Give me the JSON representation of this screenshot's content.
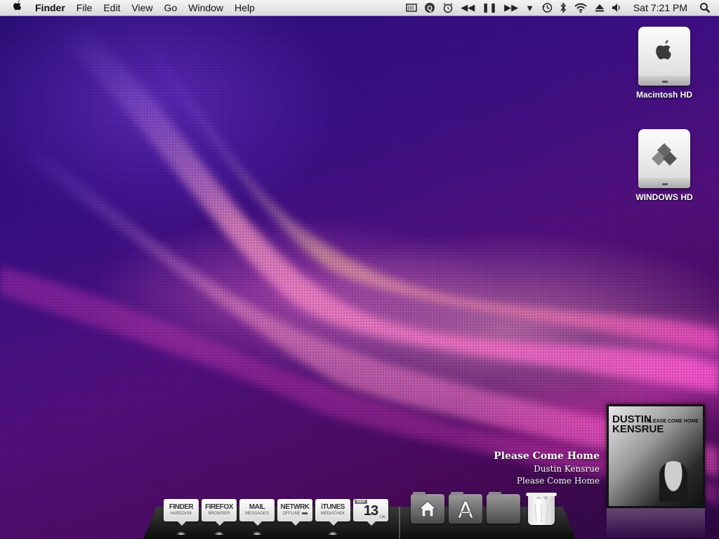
{
  "menubar": {
    "apple_glyph": "",
    "app_name": "Finder",
    "menus": [
      "File",
      "Edit",
      "View",
      "Go",
      "Window",
      "Help"
    ],
    "status_icons": [
      "menu-extra-icon",
      "quicksilver-icon",
      "alarm-icon",
      "previous-track-icon",
      "pause-icon",
      "next-track-icon",
      "dropdown-icon",
      "time-machine-icon",
      "bluetooth-icon",
      "wifi-icon",
      "eject-icon",
      "volume-icon"
    ],
    "clock": "Sat 7:21 PM",
    "spotlight_icon": "spotlight-icon"
  },
  "desktop_icons": [
    {
      "label": "Macintosh HD",
      "icon": "apple-drive-icon"
    },
    {
      "label": "WINDOWS HD",
      "icon": "windows-drive-icon"
    }
  ],
  "now_playing": {
    "title": "Please Come Home",
    "artist": "Dustin Kensrue",
    "album": "Please Come Home",
    "cover_artist": "DUSTIN KENSRUE",
    "cover_title": "PLEASE COME HOME"
  },
  "dock": {
    "tiles": [
      {
        "title": "FINDER",
        "sub": "HARDDISK"
      },
      {
        "title": "FIREFOX",
        "sub": "BROWSER"
      },
      {
        "title": "MAIL",
        "sub": "MESSAGES"
      },
      {
        "title": "NETWRK",
        "sub": "OFFLINE"
      },
      {
        "title": "iTUNES",
        "sub": "MEDIATHEK"
      }
    ],
    "calendar": {
      "month": "SEP",
      "day": "13",
      "label": "CAL"
    },
    "folders": [
      "home-folder-icon",
      "applications-folder-icon",
      "documents-folder-icon"
    ],
    "trash_icon": "trash-icon"
  },
  "colors": {
    "menubar": "#e6e6e6",
    "desktop_base": "#3a0f86",
    "accent_pink": "#ff4fd0"
  }
}
